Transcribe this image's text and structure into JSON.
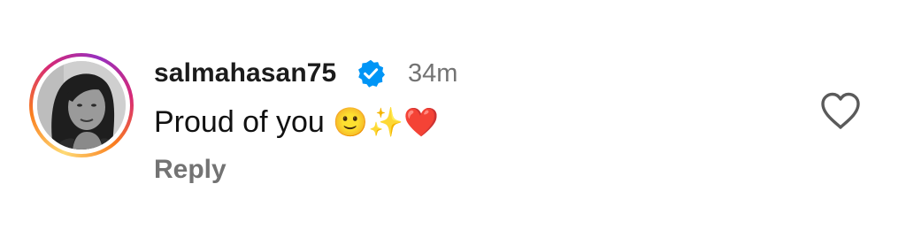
{
  "comment": {
    "username": "salmahasan75",
    "verified": true,
    "timestamp": "34m",
    "text": "Proud of you",
    "emojis": [
      "🙂",
      "✨",
      "❤️"
    ],
    "reply_label": "Reply",
    "liked": false
  },
  "icons": {
    "verified": "verified-badge-icon",
    "like": "heart-outline-icon"
  },
  "colors": {
    "verified_blue": "#0095f6",
    "secondary_text": "#737373",
    "primary_text": "#111111"
  }
}
